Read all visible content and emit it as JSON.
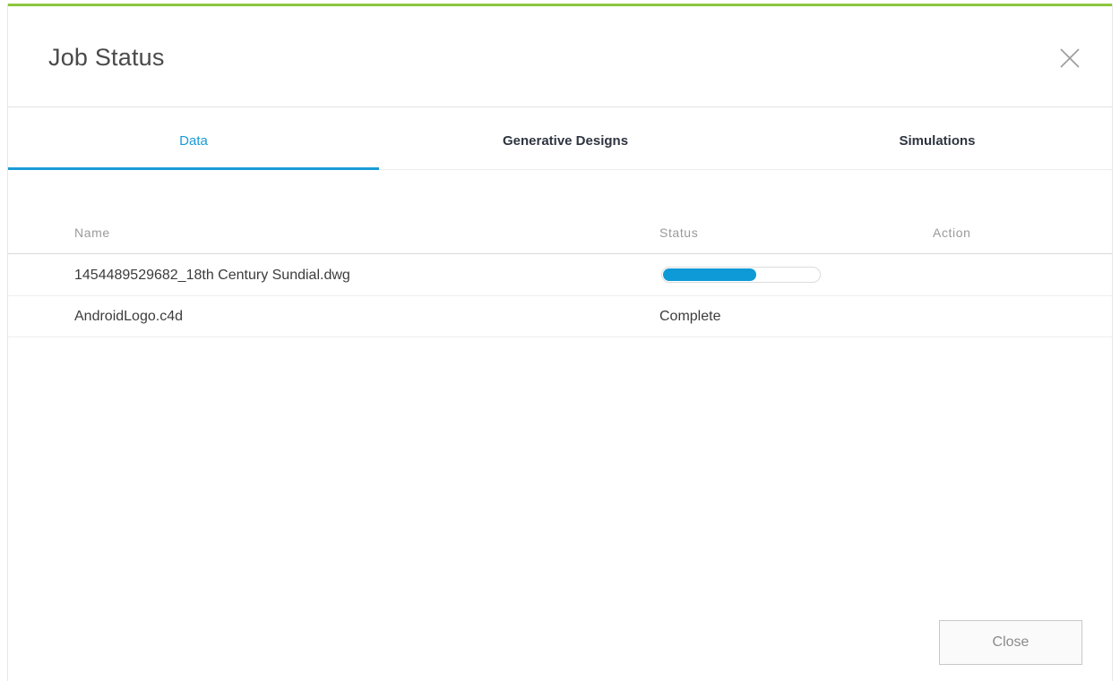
{
  "dialog": {
    "title": "Job Status",
    "accent_color": "#8dc63f",
    "close_icon": "close-x-icon"
  },
  "tabs": [
    {
      "label": "Data",
      "active": true
    },
    {
      "label": "Generative Designs",
      "active": false
    },
    {
      "label": "Simulations",
      "active": false
    }
  ],
  "table": {
    "columns": {
      "name": "Name",
      "status": "Status",
      "action": "Action"
    },
    "rows": [
      {
        "name": "1454489529682_18th Century Sundial.dwg",
        "status": "",
        "progress": 0.6,
        "action": ""
      },
      {
        "name": "AndroidLogo.c4d",
        "status": "Complete",
        "action": ""
      }
    ]
  },
  "footer": {
    "close_label": "Close"
  },
  "colors": {
    "active_tab": "#1a9bd7",
    "progress": "#0e9ad7"
  }
}
